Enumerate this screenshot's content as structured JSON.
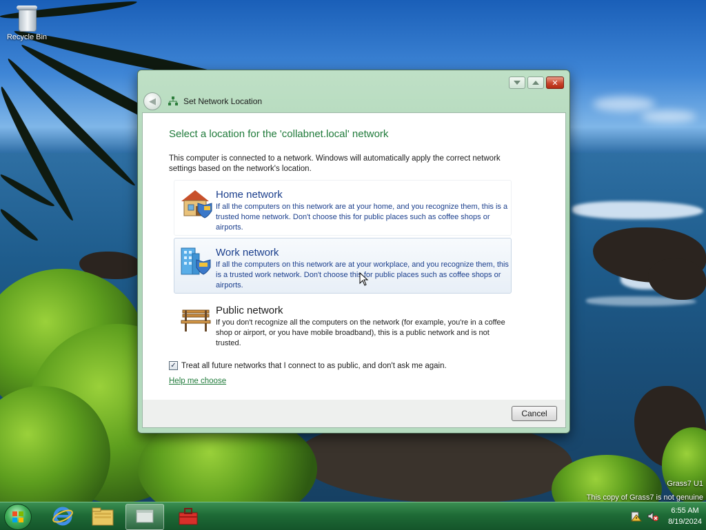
{
  "desktop": {
    "recycle_bin_label": "Recycle Bin",
    "watermark_line1": "Grass7 U1",
    "watermark_line2": "This copy of Grass7 is not genuine"
  },
  "dialog": {
    "title": "Set Network Location",
    "heading": "Select a location for the 'collabnet.local' network",
    "intro": "This computer is connected to a network. Windows will automatically apply the correct network settings based on the network's location.",
    "options": [
      {
        "title": "Home network",
        "description": "If all the computers on this network are at your home, and you recognize them, this is a trusted home network.  Don't choose this for public places such as coffee shops or airports.",
        "icon": "house-shield-icon"
      },
      {
        "title": "Work network",
        "description": "If all the computers on this network are at your workplace, and you recognize them, this is a trusted work network.  Don't choose this for public places such as coffee shops or airports.",
        "icon": "office-building-shield-icon",
        "highlighted": true
      },
      {
        "title": "Public network",
        "description": "If you don't recognize all the computers on the network (for example, you're in a coffee shop or airport, or you have mobile broadband), this is a public network and is not trusted.",
        "icon": "park-bench-icon"
      }
    ],
    "checkbox_label": "Treat all future networks that I connect to as public, and don't ask me again.",
    "checkbox_checked": true,
    "help_link": "Help me choose",
    "cancel_label": "Cancel",
    "close_glyph": "✕"
  },
  "taskbar": {
    "items": [
      "start-orb-icon",
      "internet-explorer-icon",
      "file-explorer-icon",
      "network-dialog-icon",
      "toolbox-icon"
    ],
    "time": "6:55 AM",
    "date": "8/19/2024",
    "tray_icons": [
      "action-center-warning-icon",
      "volume-muted-icon"
    ]
  },
  "colors": {
    "heading_green": "#1f7a3a",
    "option_blue": "#1a3e8c",
    "taskbar_green": "#1e6b36"
  }
}
